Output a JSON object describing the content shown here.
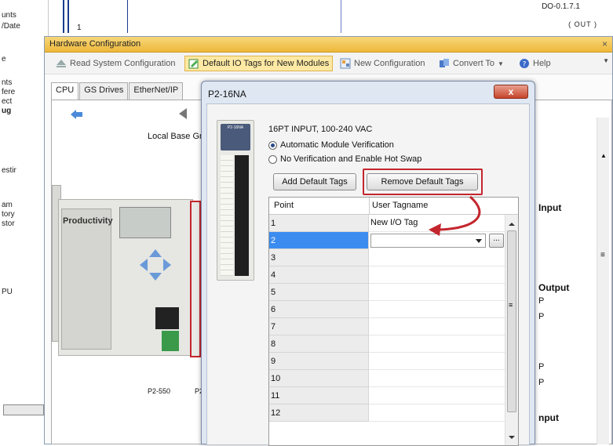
{
  "background": {
    "left_labels": [
      "unts",
      "/Date",
      "e",
      "nts",
      "fere",
      "ect",
      "ug",
      "estir",
      "am",
      "tory",
      "stor",
      "PU"
    ],
    "top_right_text": "DO-0.1.7.1",
    "top_right_text2": "( OUT )",
    "digit_one": "1"
  },
  "window": {
    "title": "Hardware Configuration",
    "close_glyph": "×",
    "toolbar": {
      "read_config": "Read System Configuration",
      "default_io_tags": "Default IO Tags for New Modules",
      "new_config": "New Configuration",
      "convert_to": "Convert To",
      "help": "Help"
    },
    "tabs": [
      "CPU",
      "GS Drives",
      "EtherNet/IP"
    ],
    "local_base": "Local Base Gr",
    "brand": "Productivity",
    "cpu_label": "P2-550",
    "cpu_label2": "P2",
    "right_panel": [
      "Input",
      "Output",
      "nput"
    ],
    "right_small": [
      "P",
      "P",
      "P",
      "P"
    ]
  },
  "dialog": {
    "title": "P2-16NA",
    "close": "x",
    "module_head": "P2-16NA",
    "description": "16PT INPUT, 100-240 VAC",
    "radio_auto": "Automatic Module Verification",
    "radio_none": "No Verification and Enable Hot Swap",
    "add_default": "Add Default Tags",
    "remove_default": "Remove Default Tags",
    "table": {
      "col_point": "Point",
      "col_user_tag": "User Tagname",
      "rows": [
        {
          "point": "1",
          "tag": "New I/O Tag"
        },
        {
          "point": "2",
          "tag": ""
        },
        {
          "point": "3",
          "tag": ""
        },
        {
          "point": "4",
          "tag": ""
        },
        {
          "point": "5",
          "tag": ""
        },
        {
          "point": "6",
          "tag": ""
        },
        {
          "point": "7",
          "tag": ""
        },
        {
          "point": "8",
          "tag": ""
        },
        {
          "point": "9",
          "tag": ""
        },
        {
          "point": "10",
          "tag": ""
        },
        {
          "point": "11",
          "tag": ""
        },
        {
          "point": "12",
          "tag": ""
        }
      ],
      "ellipsis": "..."
    }
  },
  "colors": {
    "highlight_red": "#c4262e",
    "selected_row": "#3c8cf0",
    "title_bar": "#eeb83a"
  }
}
